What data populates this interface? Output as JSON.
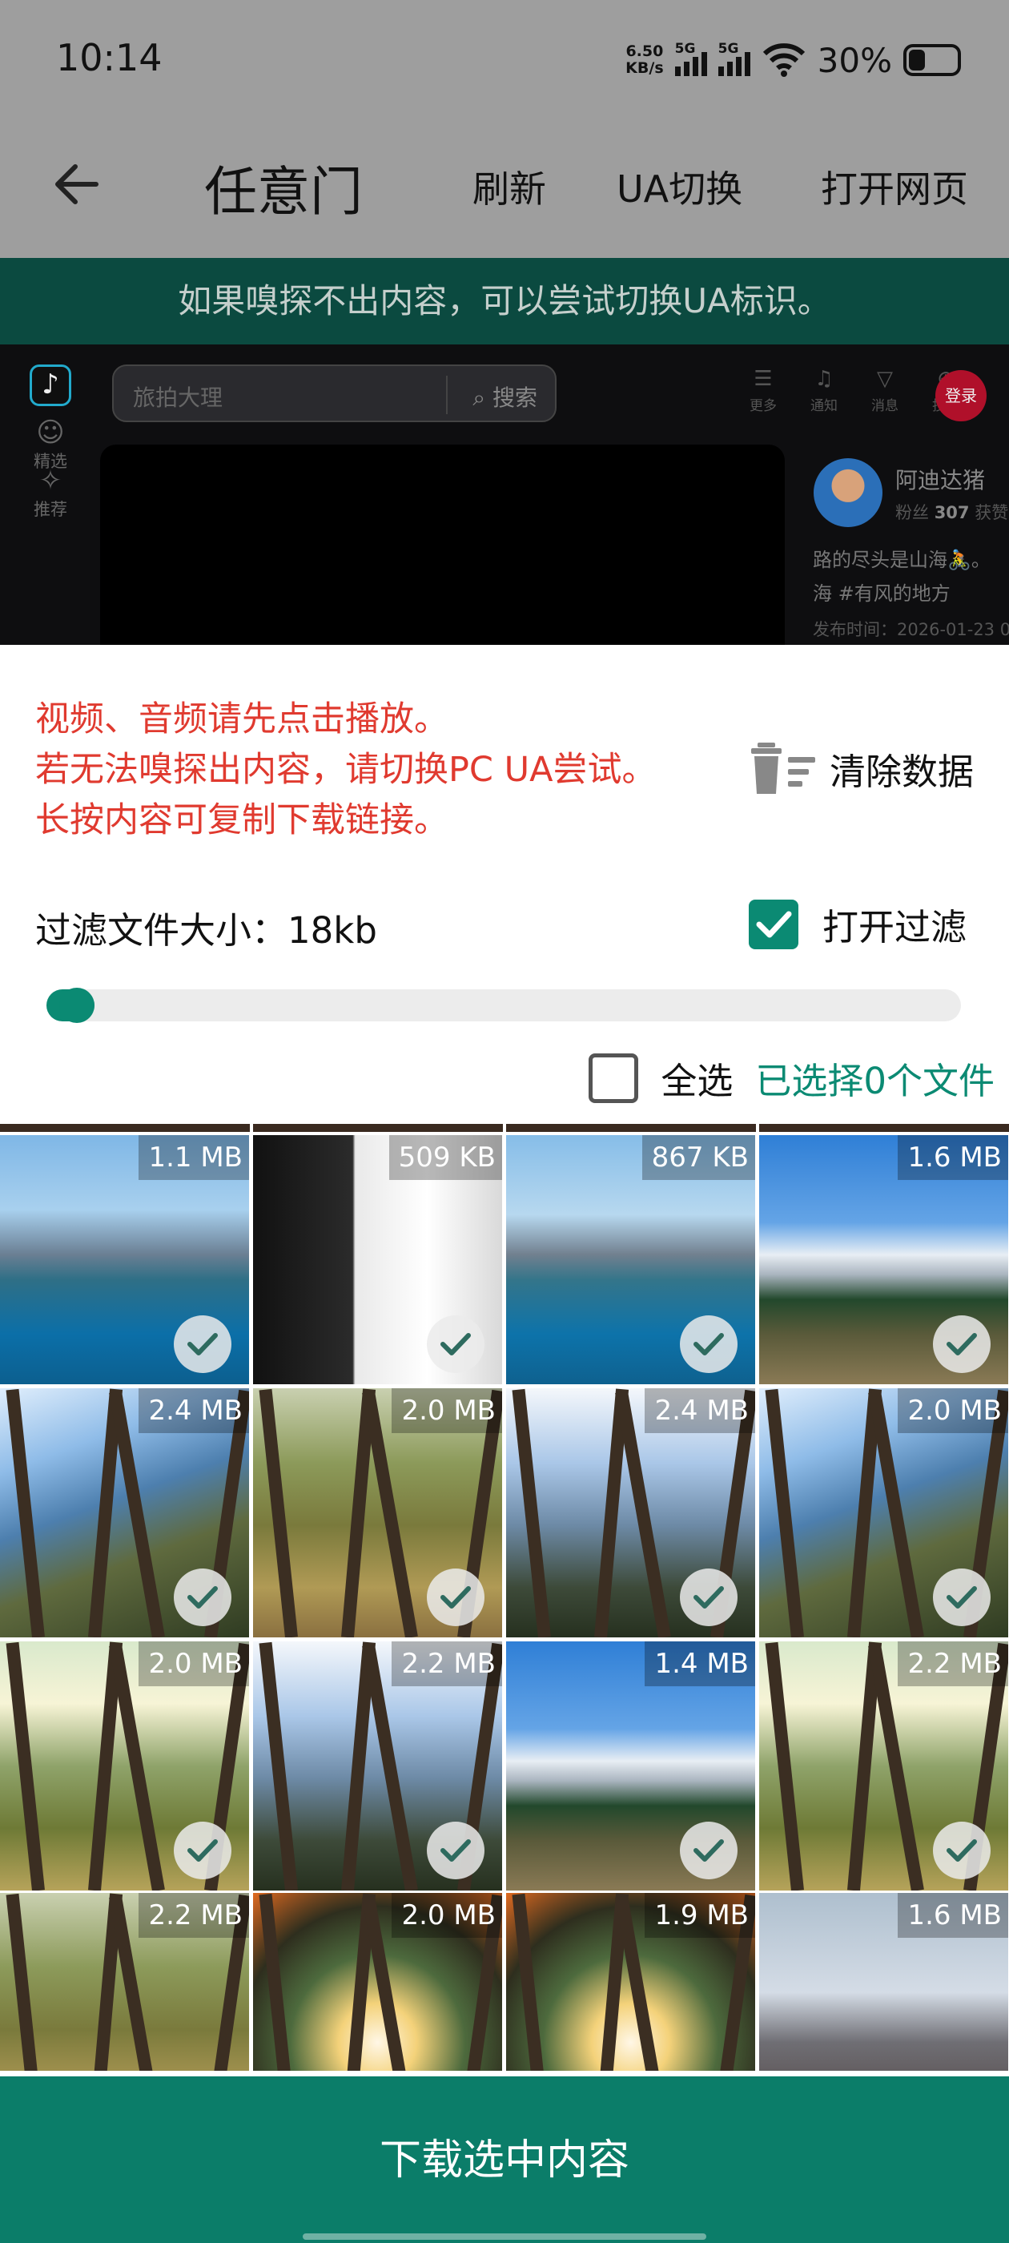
{
  "status_bar": {
    "time": "10:14",
    "net_speed_value": "6.50",
    "net_speed_unit": "KB/s",
    "signal_1_label": "5G",
    "signal_2_label": "5G",
    "battery_percent": "30%"
  },
  "toolbar": {
    "title": "任意门",
    "refresh": "刷新",
    "ua_switch": "UA切换",
    "open_webpage": "打开网页"
  },
  "notice": "如果嗅探不出内容，可以尝试切换UA标识。",
  "webpage": {
    "search_placeholder": "旅拍大理",
    "search_button": "搜索",
    "tools": [
      "更多",
      "通知",
      "消息",
      "投稿"
    ],
    "login": "登录",
    "side_nav": [
      "精选",
      "推荐"
    ],
    "author_name": "阿迪达猪",
    "fans_label": "粉丝",
    "fans_count": "307",
    "fans_extra": "获赞",
    "desc_line1": "路的尽头是山海🚴。",
    "desc_line2": "海 #有风的地方",
    "publish_time": "发布时间：2026-01-23 0"
  },
  "sheet": {
    "tip1": "视频、音频请先点击播放。",
    "tip2": "若无法嗅探出内容，请切换PC UA尝试。",
    "tip3": "长按内容可复制下载链接。",
    "clear_data": "清除数据",
    "filter_label": "过滤文件大小：18kb",
    "filter_toggle_label": "打开过滤",
    "filter_enabled": true,
    "select_all": "全选",
    "selected_count": "已选择0个文件",
    "download_button": "下载选中内容"
  },
  "tiles": [
    {
      "size": "1.1 MB",
      "scene": "lake"
    },
    {
      "size": "509 KB",
      "scene": "jersey"
    },
    {
      "size": "867 KB",
      "scene": "lake2"
    },
    {
      "size": "1.6 MB",
      "scene": "snowmtn"
    },
    {
      "size": "2.4 MB",
      "scene": "forest1"
    },
    {
      "size": "2.0 MB",
      "scene": "forest2"
    },
    {
      "size": "2.4 MB",
      "scene": "forest3"
    },
    {
      "size": "2.0 MB",
      "scene": "forest1"
    },
    {
      "size": "2.0 MB",
      "scene": "forest4"
    },
    {
      "size": "2.2 MB",
      "scene": "forest3"
    },
    {
      "size": "1.4 MB",
      "scene": "snowmtn"
    },
    {
      "size": "2.2 MB",
      "scene": "forest4"
    },
    {
      "size": "2.2 MB",
      "scene": "forest2"
    },
    {
      "size": "2.0 MB",
      "scene": "orange"
    },
    {
      "size": "1.9 MB",
      "scene": "orange"
    },
    {
      "size": "1.6 MB",
      "scene": "person"
    }
  ],
  "colors": {
    "accent": "#0b8a73",
    "download_bg": "#0b7d69",
    "tip_text": "#e03a2f",
    "notice_bg": "#0b4a40"
  }
}
